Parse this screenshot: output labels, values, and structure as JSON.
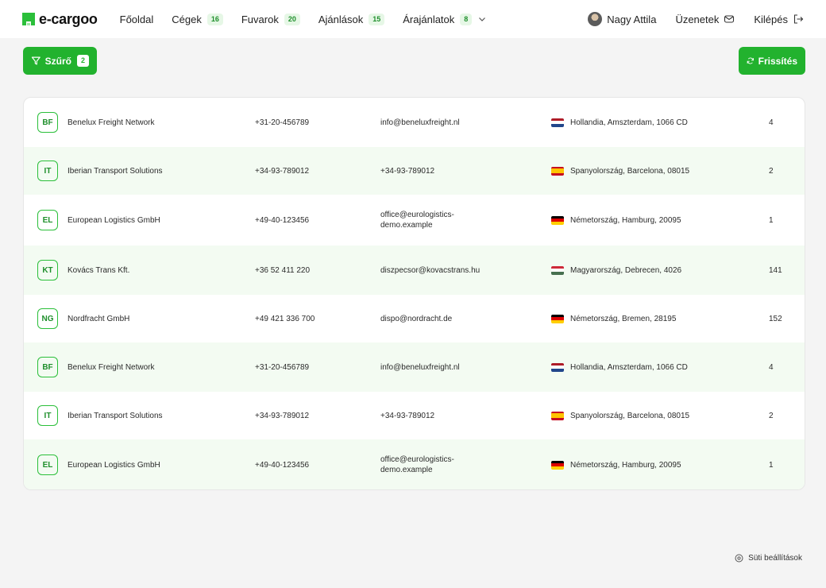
{
  "brand": {
    "name": "e-cargoo"
  },
  "nav": [
    {
      "label": "Főoldal",
      "badge": null
    },
    {
      "label": "Cégek",
      "badge": "16"
    },
    {
      "label": "Fuvarok",
      "badge": "20"
    },
    {
      "label": "Ajánlások",
      "badge": "15"
    },
    {
      "label": "Árajánlatok",
      "badge": "8",
      "dropdown": true
    }
  ],
  "user": {
    "name": "Nagy Attila"
  },
  "messages_label": "Üzenetek",
  "logout_label": "Kilépés",
  "filter": {
    "label": "Szűrő",
    "count": "2"
  },
  "refresh_label": "Frissítés",
  "companies": [
    {
      "initials": "BF",
      "name": "Benelux Freight Network",
      "phone": "+31-20-456789",
      "email": "info@beneluxfreight.nl",
      "country": "nl",
      "address": "Hollandia, Amszterdam, 1066 CD",
      "count": "4"
    },
    {
      "initials": "IT",
      "name": "Iberian Transport Solutions",
      "phone": "+34-93-789012",
      "email": "+34-93-789012",
      "country": "es",
      "address": "Spanyolország, Barcelona, 08015",
      "count": "2"
    },
    {
      "initials": "EL",
      "name": "European Logistics GmbH",
      "phone": "+49-40-123456",
      "email": "office@eurologistics-demo.example",
      "country": "de",
      "address": "Németország, Hamburg, 20095",
      "count": "1"
    },
    {
      "initials": "KT",
      "name": "Kovács Trans Kft.",
      "phone": "+36 52 411 220",
      "email": "diszpecsor@kovacstrans.hu",
      "country": "hu",
      "address": "Magyarország, Debrecen, 4026",
      "count": "141"
    },
    {
      "initials": "NG",
      "name": "Nordfracht GmbH",
      "phone": "+49 421 336 700",
      "email": "dispo@nordracht.de",
      "country": "de",
      "address": "Németország, Bremen, 28195",
      "count": "152"
    },
    {
      "initials": "BF",
      "name": "Benelux Freight Network",
      "phone": "+31-20-456789",
      "email": "info@beneluxfreight.nl",
      "country": "nl",
      "address": "Hollandia, Amszterdam, 1066 CD",
      "count": "4"
    },
    {
      "initials": "IT",
      "name": "Iberian Transport Solutions",
      "phone": "+34-93-789012",
      "email": "+34-93-789012",
      "country": "es",
      "address": "Spanyolország, Barcelona, 08015",
      "count": "2"
    },
    {
      "initials": "EL",
      "name": "European Logistics GmbH",
      "phone": "+49-40-123456",
      "email": "office@eurologistics-demo.example",
      "country": "de",
      "address": "Németország, Hamburg, 20095",
      "count": "1"
    }
  ],
  "flag_colors": {
    "nl": [
      "#ae1c28",
      "#ffffff",
      "#21468b"
    ],
    "es": [
      "#c60b1e",
      "#ffc400",
      "#c60b1e"
    ],
    "de": [
      "#000000",
      "#dd0000",
      "#ffce00"
    ],
    "hu": [
      "#ce2939",
      "#ffffff",
      "#477050"
    ]
  },
  "cookie_label": "Süti beállítások",
  "colors": {
    "accent": "#22b22e",
    "row_alt": "#f3fbf2"
  }
}
